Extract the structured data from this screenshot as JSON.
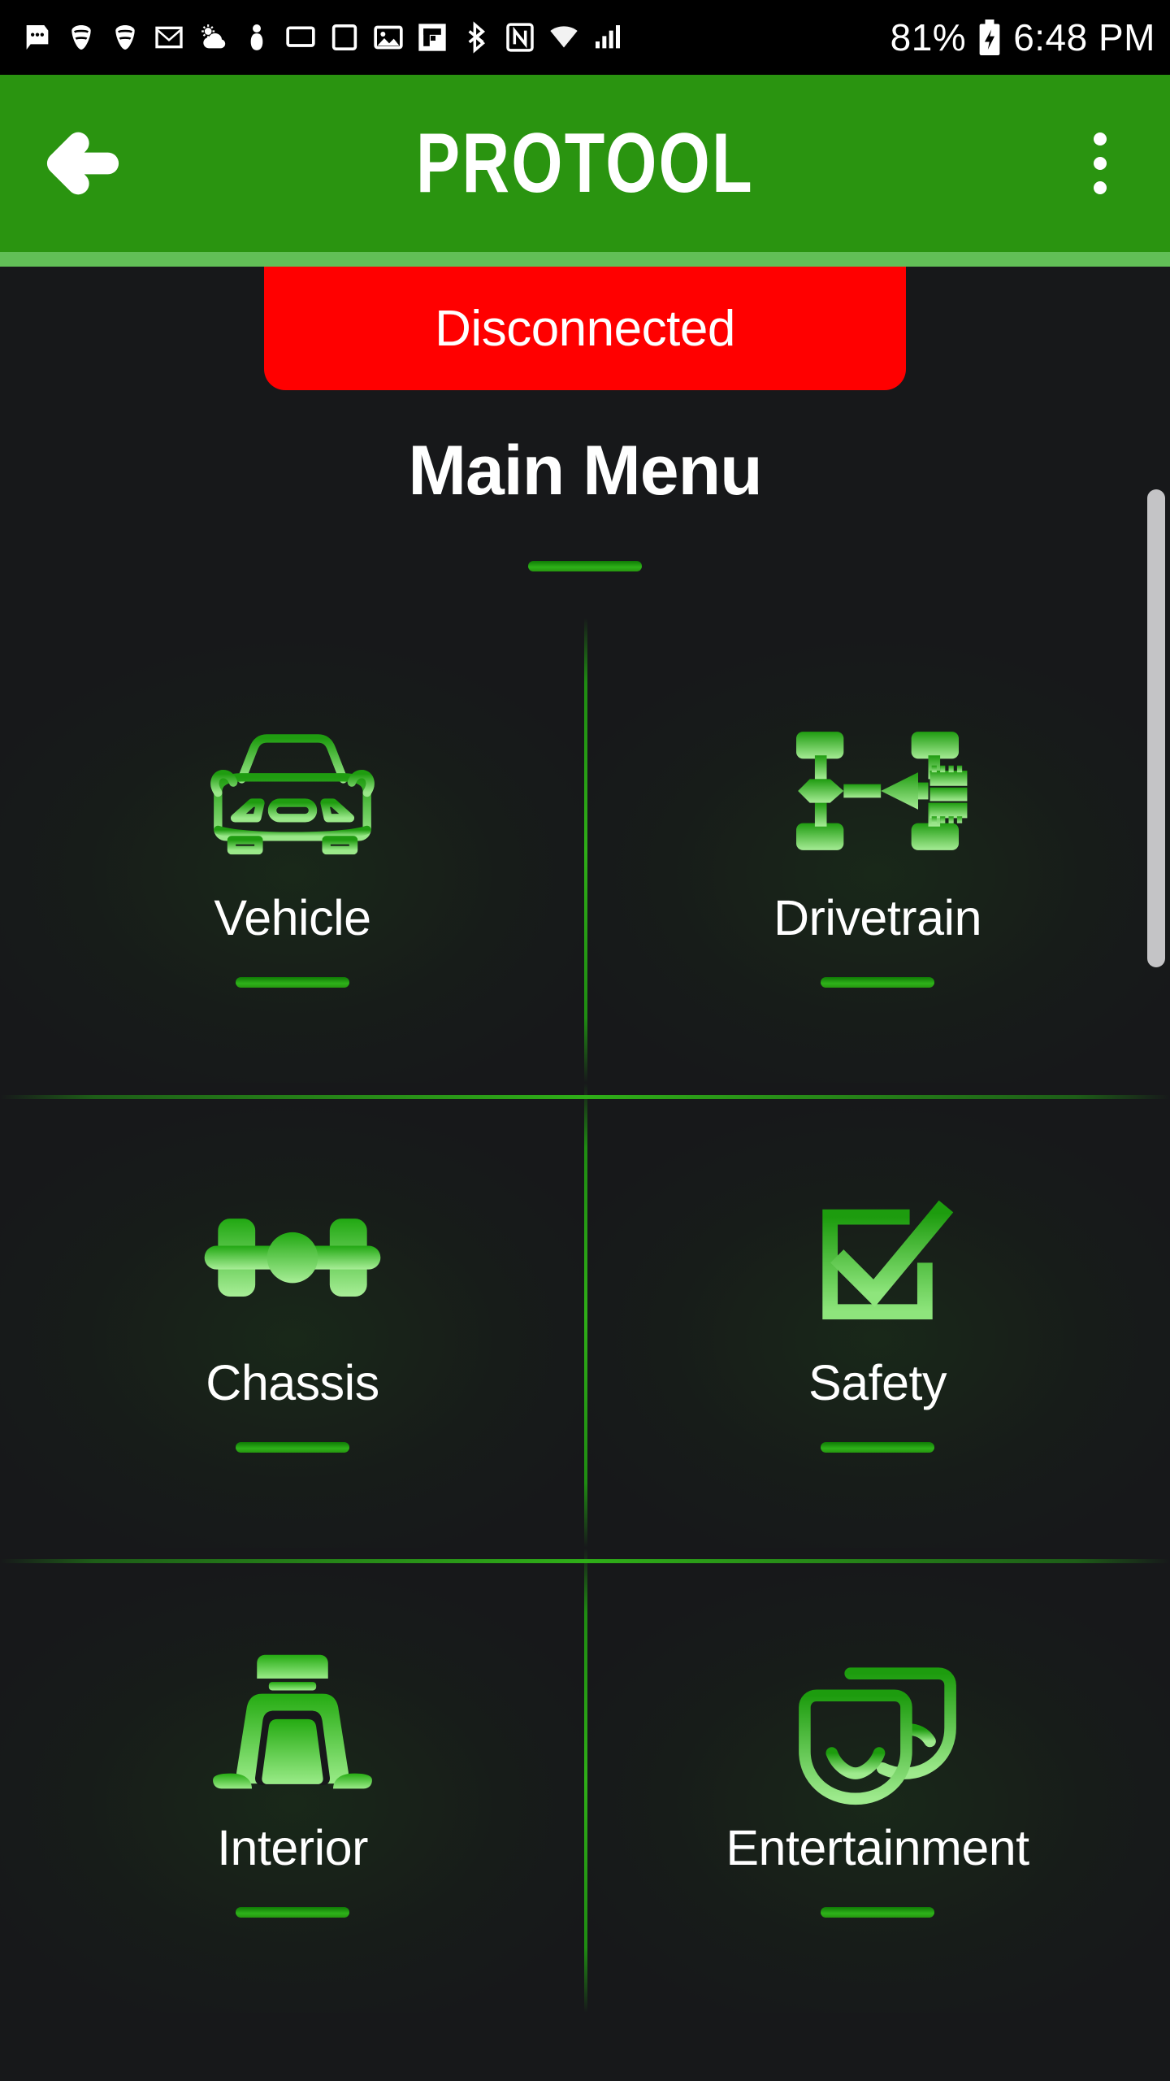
{
  "status_bar": {
    "icons": [
      "messages-icon",
      "wifi-icon",
      "wifi-icon-2",
      "gmail-icon",
      "weather-icon",
      "person-icon",
      "cast-icon",
      "screen-icon",
      "photo-icon",
      "flipboard-icon",
      "bluetooth-icon",
      "nfc-icon",
      "wifi-signal-icon",
      "cell-signal-icon"
    ],
    "battery_percent": "81%",
    "battery_icon": "battery-charging-icon",
    "time": "6:48 PM"
  },
  "app_bar": {
    "back_icon": "back-arrow-icon",
    "title": "PROTOOL",
    "overflow_icon": "more-vertical-icon",
    "bar_color": "#2a9410",
    "accent_color": "#62bf57"
  },
  "connection": {
    "label": "Disconnected",
    "color": "#ff0000"
  },
  "page": {
    "title": "Main Menu"
  },
  "menu": {
    "items": [
      {
        "label": "Vehicle",
        "icon": "car-front-icon"
      },
      {
        "label": "Drivetrain",
        "icon": "drivetrain-icon"
      },
      {
        "label": "Chassis",
        "icon": "chassis-axle-icon"
      },
      {
        "label": "Safety",
        "icon": "checkbox-check-icon"
      },
      {
        "label": "Interior",
        "icon": "car-seat-icon"
      },
      {
        "label": "Entertainment",
        "icon": "theater-masks-icon"
      }
    ]
  },
  "scrollbar": {
    "name": "vertical-scrollbar"
  },
  "theme": {
    "background": "#17181a",
    "icon_green_top": "#2fae18",
    "icon_green_bottom": "#8ae07a",
    "underline_green": "#26960f"
  }
}
